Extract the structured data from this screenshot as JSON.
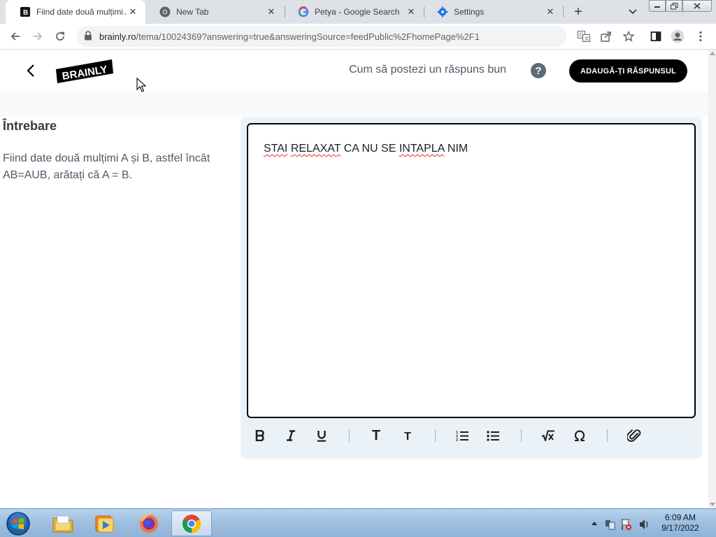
{
  "browser": {
    "tabs": [
      {
        "title": "Fiind date două mulțimi A",
        "icon": "brainly-favicon-icon",
        "active": true
      },
      {
        "title": "New Tab",
        "icon": "chrome-icon",
        "active": false
      },
      {
        "title": "Petya - Google Search",
        "icon": "google-icon",
        "active": false
      },
      {
        "title": "Settings",
        "icon": "gear-icon",
        "active": false
      }
    ],
    "url_host": "brainly.ro",
    "url_path": "/tema/10024369?answering=true&answeringSource=feedPublic%2FhomePage%2F1"
  },
  "page": {
    "logo_text": "BRAINLY",
    "how_to_text": "Cum să postezi un răspuns bun",
    "help_symbol": "?",
    "add_answer_label": "ADAUGĂ-ȚI RĂSPUNSUL",
    "question_heading": "Întrebare",
    "question_text": "Fiind date două mulțimi A și B, astfel încât AB=AUB, arătați că A = B.",
    "answer_text": "STAI RELAXAT CA NU SE INTAPLA NIM",
    "answer_words": [
      "STAI",
      " ",
      "RELAXAT",
      " CA NU SE ",
      "INTAPLA",
      " NIM"
    ]
  },
  "editor_toolbar": {
    "tools": [
      "bold",
      "italic",
      "underline",
      "heading-large",
      "heading-small",
      "numbered-list",
      "bulleted-list",
      "math-formula",
      "special-symbol",
      "attach"
    ],
    "heading_glyph": "T"
  },
  "taskbar": {
    "apps": [
      "file-explorer-icon",
      "media-player-icon",
      "firefox-icon",
      "chrome-icon"
    ],
    "time": "6:09 AM",
    "date": "9/17/2022"
  },
  "colors": {
    "accent_black": "#000000",
    "editor_panel_bg": "#ebf2f7",
    "text_gray": "#4e5a66",
    "spell_underline": "#e0302f"
  }
}
